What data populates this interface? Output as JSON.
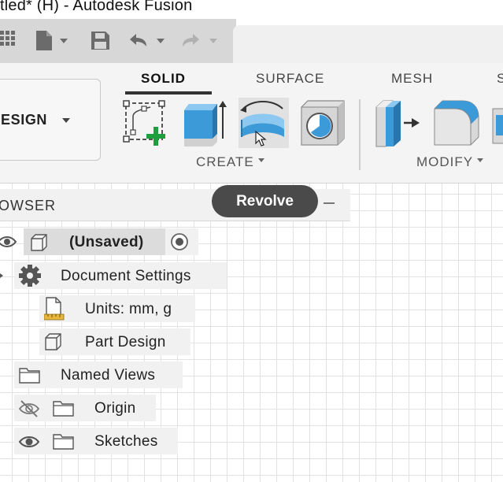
{
  "window": {
    "title": "tled* (H) - Autodesk Fusion"
  },
  "quick_access": {
    "icons": [
      "grid-icon",
      "file-icon",
      "save-icon",
      "undo-icon",
      "redo-icon"
    ]
  },
  "workspace": {
    "label": "ESIGN"
  },
  "tabs": [
    {
      "label": "SOLID",
      "active": true
    },
    {
      "label": "SURFACE",
      "active": false
    },
    {
      "label": "MESH",
      "active": false
    },
    {
      "label": "S",
      "active": false
    }
  ],
  "groups": {
    "create": {
      "label": "CREATE"
    },
    "modify": {
      "label": "MODIFY"
    }
  },
  "tools": [
    {
      "name": "create-sketch",
      "icon": "create-sketch-icon"
    },
    {
      "name": "extrude",
      "icon": "extrude-icon"
    },
    {
      "name": "revolve",
      "icon": "revolve-icon",
      "hovered": true
    },
    {
      "name": "hole",
      "icon": "hole-icon"
    },
    {
      "name": "press-pull",
      "icon": "press-pull-icon"
    },
    {
      "name": "fillet",
      "icon": "fillet-icon"
    }
  ],
  "tooltip": {
    "text": "Revolve"
  },
  "browser": {
    "title": "OWSER",
    "root": {
      "label": "(Unsaved)"
    },
    "items": [
      {
        "label": "Document Settings"
      },
      {
        "label": "Units: mm, g"
      },
      {
        "label": "Part Design"
      },
      {
        "label": "Named Views"
      },
      {
        "label": "Origin"
      },
      {
        "label": "Sketches"
      }
    ]
  },
  "colors": {
    "accent_blue": "#3d9ad8",
    "plus_green": "#1e9e3e",
    "tooltip_bg": "#4a4a4a"
  }
}
